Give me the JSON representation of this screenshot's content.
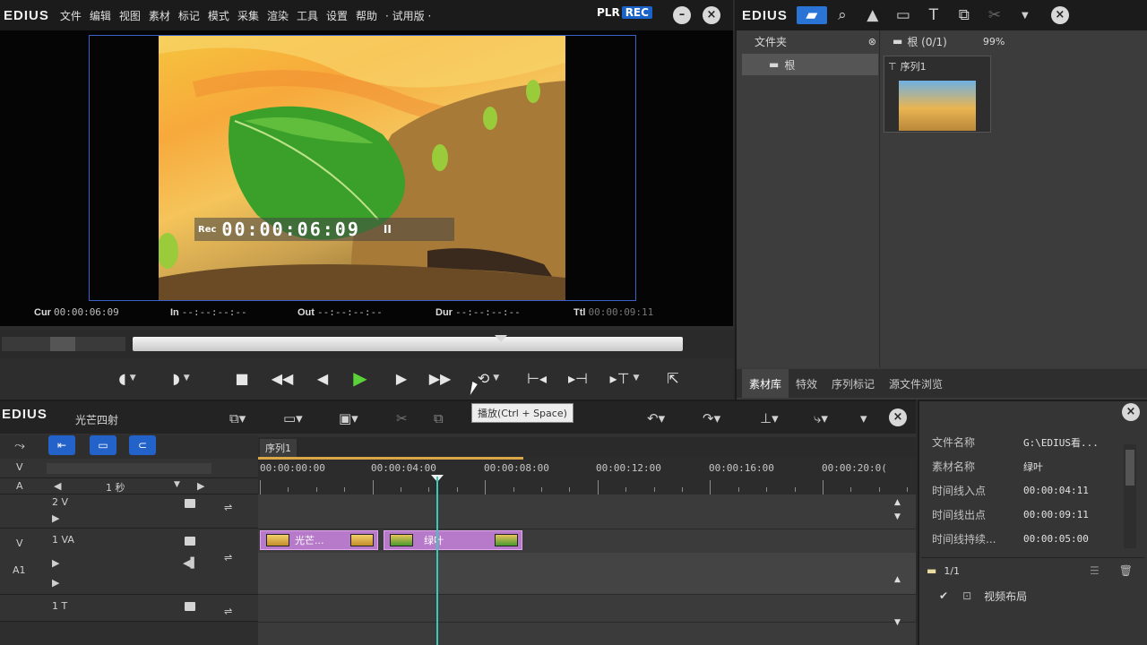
{
  "player": {
    "logo": "EDIUS",
    "menu": [
      "文件",
      "编辑",
      "视图",
      "素材",
      "标记",
      "模式",
      "采集",
      "渲染",
      "工具",
      "设置",
      "帮助",
      "试用版"
    ],
    "plr": "PLR",
    "rec": "REC",
    "minimize": "–",
    "close": "×",
    "overlay": {
      "label": "Rec",
      "timecode": "00:00:06:09",
      "pause": "II"
    },
    "info": {
      "cur_label": "Cur",
      "cur_value": "00:00:06:09",
      "in_label": "In",
      "in_value": "--:--:--:--",
      "out_label": "Out",
      "out_value": "--:--:--:--",
      "dur_label": "Dur",
      "dur_value": "--:--:--:--",
      "ttl_label": "Ttl",
      "ttl_value": "00:00:09:11"
    },
    "playhead_fraction": 0.67
  },
  "bin": {
    "logo": "EDIUS",
    "folder_header": "文件夹",
    "path": "根 (0/1)",
    "zoom": "99%",
    "root_folder": "根",
    "clip_name": "序列1",
    "tabs": [
      "素材库",
      "特效",
      "序列标记",
      "源文件浏览"
    ]
  },
  "timeline": {
    "logo": "EDIUS",
    "project": "光芒四射",
    "sequence_tab": "序列1",
    "scale": "1 秒",
    "ruler": [
      "00:00:00:00",
      "00:00:04:00",
      "00:00:08:00",
      "00:00:12:00",
      "00:00:16:00",
      "00:00:20:0("
    ],
    "tracks": {
      "v": "V",
      "a": "A",
      "t2v": "2 V",
      "t1va_side": "V",
      "t1va": "1 VA",
      "a1": "A1",
      "t1t": "1 T"
    },
    "clips": [
      {
        "label": "光芒...",
        "start": 0.0,
        "end": 1.05
      },
      {
        "label": "绿叶",
        "start": 1.1,
        "end": 2.33
      }
    ],
    "tooltip": "播放(Ctrl + Space)"
  },
  "info_panel": {
    "rows": [
      {
        "key": "文件名称",
        "value": "G:\\EDIUS看..."
      },
      {
        "key": "素材名称",
        "value": "绿叶"
      },
      {
        "key": "时间线入点",
        "value": "00:00:04:11"
      },
      {
        "key": "时间线出点",
        "value": "00:00:09:11"
      },
      {
        "key": "时间线持续...",
        "value": "00:00:05:00"
      }
    ],
    "count": "1/1",
    "effect": "视频布局"
  }
}
